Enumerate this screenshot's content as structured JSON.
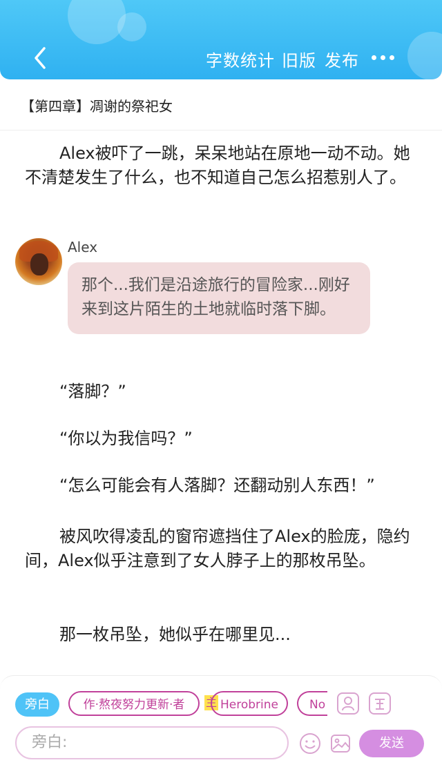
{
  "header": {
    "word_count_label": "字数统计",
    "old_version_label": "旧版",
    "publish_label": "发布"
  },
  "chapter_title": "【第四章】凋谢的祭祀女",
  "paragraphs": [
    "Alex被吓了一跳，呆呆地站在原地一动不动。她不清楚发生了什么，也不知道自己怎么招惹别人了。",
    "“落脚？”",
    "“你以为我信吗？”",
    "“怎么可能会有人落脚？还翻动别人东西！”",
    "被风吹得凌乱的窗帘遮挡住了Alex的脸庞，隐约间，Alex似乎注意到了女人脖子上的那枚吊坠。",
    "那一枚吊坠，她似乎在哪里见..."
  ],
  "dialogue": {
    "speaker": "Alex",
    "text": "那个...我们是沿途旅行的冒险家...刚好来到这片陌生的土地就临时落下脚。"
  },
  "toolbar": {
    "narration_chip": "旁白",
    "role_chip_author": "作·熬夜努力更新·者",
    "main_tag": "主",
    "role_chip_herobrine": "Herobrine",
    "role_chip_partial": "No",
    "input_placeholder": "旁白:",
    "send_label": "发送"
  },
  "colors": {
    "header_blue": "#2fb1f1",
    "accent_pink": "#c0409a",
    "bubble_bg": "#f2dcdd",
    "send_bg": "#d58ee1"
  }
}
